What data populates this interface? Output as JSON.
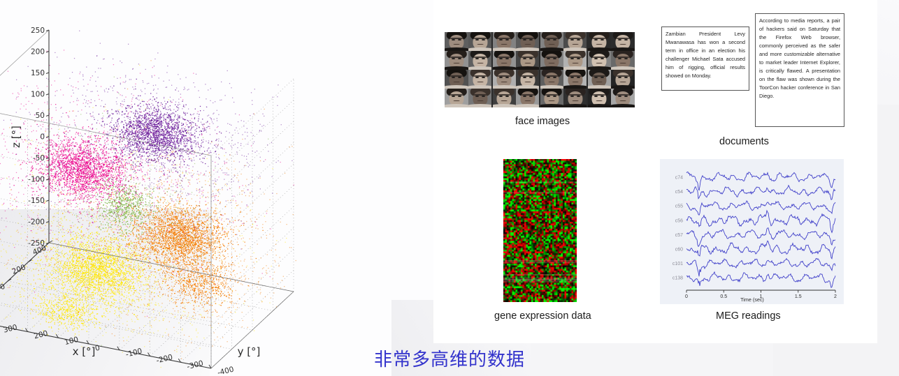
{
  "slide": {
    "chinese_title": "非常多高维的数据"
  },
  "scatter": {
    "axis_titles": {
      "x": "x [°]",
      "y": "y [°]",
      "z": "z [°]"
    },
    "z_ticks": [
      "250",
      "200",
      "150",
      "100",
      "50",
      "0",
      "-50",
      "-100",
      "-150",
      "-200",
      "-250"
    ],
    "x_ticks": [
      "400",
      "200",
      "0",
      "-200",
      "-400"
    ],
    "y_ticks": [
      "400",
      "300",
      "200",
      "100",
      "0",
      "-100",
      "-200",
      "-300",
      "-400"
    ],
    "clusters": [
      {
        "name": "purple",
        "color": "#6a1b9a"
      },
      {
        "name": "magenta",
        "color": "#ec008c"
      },
      {
        "name": "orange",
        "color": "#f57c00"
      },
      {
        "name": "yellow",
        "color": "#ffe800"
      },
      {
        "name": "green",
        "color": "#7cb342"
      }
    ]
  },
  "chart_data": {
    "type": "scatter",
    "title": "",
    "xlabel": "x [°]",
    "ylabel": "y [°]",
    "zlabel": "z [°]",
    "xlim": [
      -400,
      400
    ],
    "ylim": [
      -400,
      400
    ],
    "zlim": [
      -250,
      250
    ],
    "xticks": [
      400,
      200,
      0,
      -200,
      -400
    ],
    "yticks": [
      400,
      300,
      200,
      100,
      0,
      -100,
      -200,
      -300,
      -400
    ],
    "zticks": [
      250,
      200,
      150,
      100,
      50,
      0,
      -50,
      -100,
      -150,
      -200,
      -250
    ],
    "grid": true,
    "legend": "none",
    "series": [
      {
        "name": "cluster-purple",
        "color": "#6a1b9a",
        "center": [
          60,
          -60,
          150
        ],
        "spread": [
          110,
          110,
          45
        ],
        "n": 3000
      },
      {
        "name": "cluster-magenta",
        "color": "#ec008c",
        "center": [
          -110,
          120,
          80
        ],
        "spread": [
          130,
          110,
          45
        ],
        "n": 3000
      },
      {
        "name": "cluster-orange",
        "color": "#f57c00",
        "center": [
          90,
          -130,
          -90
        ],
        "spread": [
          120,
          110,
          50
        ],
        "n": 3500
      },
      {
        "name": "cluster-yellow",
        "color": "#ffe800",
        "center": [
          -150,
          60,
          -140
        ],
        "spread": [
          130,
          120,
          55
        ],
        "n": 3500
      },
      {
        "name": "cluster-green",
        "color": "#7cb342",
        "center": [
          -30,
          10,
          -10
        ],
        "spread": [
          70,
          70,
          40
        ],
        "n": 900
      },
      {
        "name": "cluster-yellow-low",
        "color": "#ffe800",
        "center": [
          -170,
          150,
          -250
        ],
        "spread": [
          90,
          80,
          30
        ],
        "n": 900
      },
      {
        "name": "cluster-orange-low",
        "color": "#f57c00",
        "center": [
          140,
          -180,
          -205
        ],
        "spread": [
          100,
          90,
          35
        ],
        "n": 900
      }
    ]
  },
  "faces": {
    "caption": "face images",
    "columns": 8,
    "rows": 4,
    "separator_after_columns": [
      2,
      4,
      6
    ]
  },
  "documents": {
    "caption": "documents",
    "items": [
      {
        "id": "doc-1",
        "text": "Zambian President Levy Mwanawasa has won a second term in office in an election his challenger Michael Sata accused him of rigging, official results showed on Monday."
      },
      {
        "id": "doc-2",
        "text": "According to media reports, a pair of hackers said on Saturday that the Firefox Web browser, commonly perceived as the safer and more customizable alternative to market leader Internet Explorer, is critically flawed. A presentation on the flaw was shown during the ToorCon hacker conference in San Diego."
      }
    ]
  },
  "gene": {
    "caption": "gene expression data",
    "colors": {
      "high": "#ff0000",
      "low": "#00ff00",
      "mid": "#000000"
    },
    "cols": 42,
    "rows": 82
  },
  "meg": {
    "caption": "MEG readings",
    "channels": [
      "c74",
      "c54",
      "c55",
      "c56",
      "c57",
      "c60",
      "c101",
      "c138"
    ],
    "x_ticks": [
      "0",
      "0.5",
      "1",
      "1.5",
      "2"
    ],
    "x_label": "Time (sec)",
    "trace_color": "#3a3ac8",
    "bg_color": "#eef1f7"
  }
}
